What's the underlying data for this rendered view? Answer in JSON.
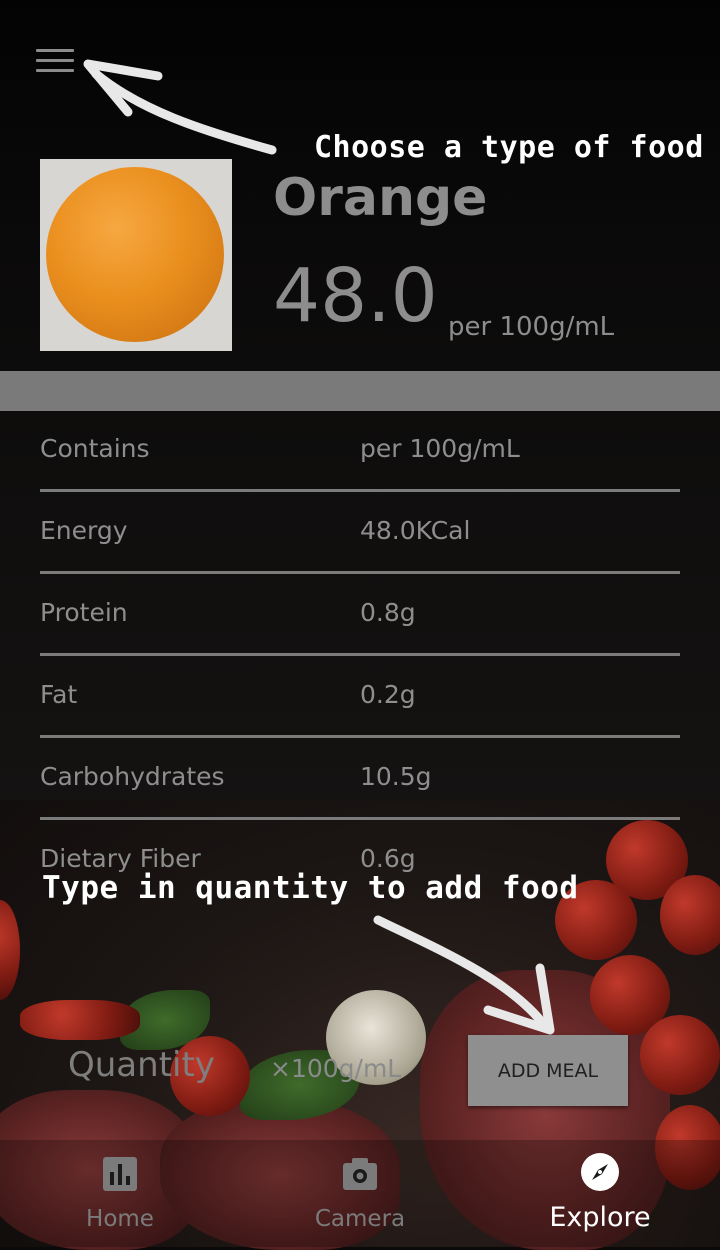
{
  "tutorial": {
    "menu_hint": "Choose a type of food",
    "quantity_hint": "Type in quantity to add food"
  },
  "food": {
    "name": "Orange",
    "calories": "48.0",
    "per_unit": "per 100g/mL",
    "image_icon": "orange-photo"
  },
  "nutrition": {
    "header": {
      "label": "Contains",
      "value": "per 100g/mL"
    },
    "rows": [
      {
        "label": "Energy",
        "value": "48.0KCal"
      },
      {
        "label": "Protein",
        "value": "0.8g"
      },
      {
        "label": "Fat",
        "value": "0.2g"
      },
      {
        "label": "Carbohydrates",
        "value": "10.5g"
      },
      {
        "label": "Dietary Fiber",
        "value": "0.6g"
      }
    ]
  },
  "quantity": {
    "placeholder": "Quantity",
    "unit": "×100g/mL"
  },
  "actions": {
    "add_meal": "ADD MEAL"
  },
  "bottom_nav": {
    "items": [
      {
        "label": "Home",
        "icon": "bar-chart-icon",
        "active": false
      },
      {
        "label": "Camera",
        "icon": "camera-icon",
        "active": false
      },
      {
        "label": "Explore",
        "icon": "compass-icon",
        "active": true
      }
    ]
  },
  "colors": {
    "text_dim": "#8d8d8d",
    "button_bg": "#8f8f8f",
    "active_nav": "#ffffff"
  }
}
